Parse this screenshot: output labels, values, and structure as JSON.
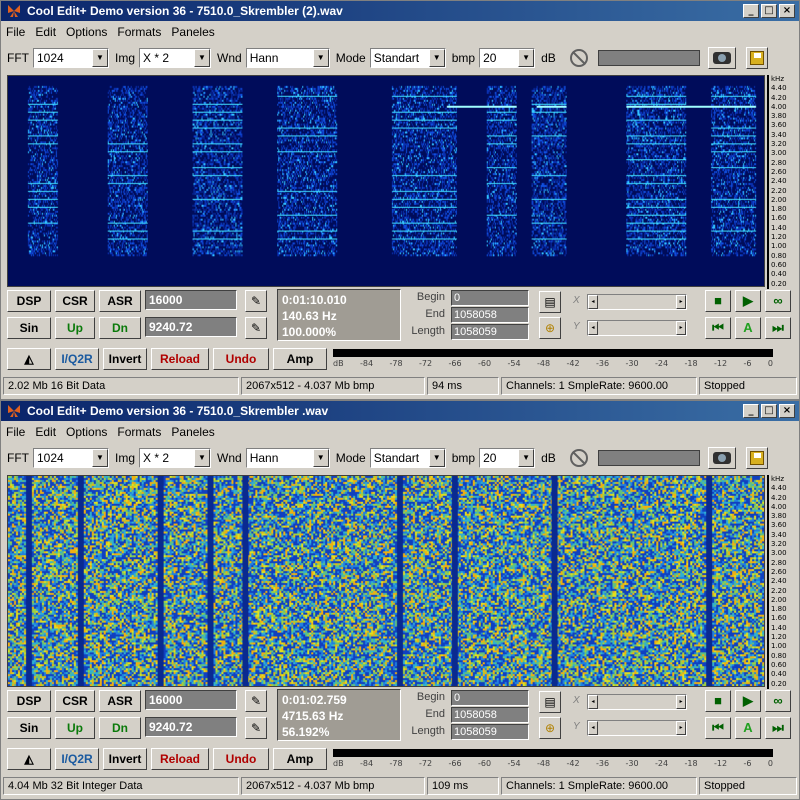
{
  "windows": [
    {
      "title": "Cool Edit+  Demo version 36 - 7510.0_Skrembler  (2).wav",
      "menu": [
        "File",
        "Edit",
        "Options",
        "Formats",
        "Paneles"
      ],
      "toolbar": {
        "fft_label": "FFT",
        "fft": "1024",
        "img_label": "Img",
        "img": "X * 2",
        "wnd_label": "Wnd",
        "wnd": "Hann",
        "mode_label": "Mode",
        "mode": "Standart",
        "bmp_label": "bmp",
        "bmp": "20",
        "db_label": "dB"
      },
      "khz_scale": [
        "kHz",
        "4.40",
        "4.20",
        "4.00",
        "3.80",
        "3.60",
        "3.40",
        "3.20",
        "3.00",
        "2.80",
        "2.60",
        "2.40",
        "2.20",
        "2.00",
        "1.80",
        "1.60",
        "1.40",
        "1.20",
        "1.00",
        "0.80",
        "0.60",
        "0.40",
        "0.20"
      ],
      "buttons": {
        "dsp": "DSP",
        "csr": "CSR",
        "asr": "ASR",
        "sin": "Sin",
        "up": "Up",
        "dn": "Dn"
      },
      "fields": {
        "rate": "16000",
        "freq": "9240.72"
      },
      "readout": {
        "time": "0:01:10.010",
        "hz": "140.63 Hz",
        "pct": "100.000%"
      },
      "range": {
        "begin_label": "Begin",
        "begin": "0",
        "end_label": "End",
        "end": "1058058",
        "length_label": "Length",
        "length": "1058059"
      },
      "axis": {
        "x": "X",
        "y": "Y"
      },
      "row3": {
        "iq": "I/Q2R",
        "invert": "Invert",
        "reload": "Reload",
        "undo": "Undo",
        "amp": "Amp"
      },
      "vu_ticks": [
        "dB",
        "-84",
        "-78",
        "-72",
        "-66",
        "-60",
        "-54",
        "-48",
        "-42",
        "-36",
        "-30",
        "-24",
        "-18",
        "-12",
        "-6",
        "0"
      ],
      "status": [
        "2.02 Mb 16 Bit Data",
        "2067x512 - 4.037 Mb bmp",
        "94 ms",
        "Channels: 1  SmpleRate: 9600.00",
        "Stopped"
      ]
    },
    {
      "title": "Cool Edit+  Demo version 36 - 7510.0_Skrembler .wav",
      "menu": [
        "File",
        "Edit",
        "Options",
        "Formats",
        "Paneles"
      ],
      "toolbar": {
        "fft_label": "FFT",
        "fft": "1024",
        "img_label": "Img",
        "img": "X * 2",
        "wnd_label": "Wnd",
        "wnd": "Hann",
        "mode_label": "Mode",
        "mode": "Standart",
        "bmp_label": "bmp",
        "bmp": "20",
        "db_label": "dB"
      },
      "khz_scale": [
        "kHz",
        "4.40",
        "4.20",
        "4.00",
        "3.80",
        "3.60",
        "3.40",
        "3.20",
        "3.00",
        "2.80",
        "2.60",
        "2.40",
        "2.20",
        "2.00",
        "1.80",
        "1.60",
        "1.40",
        "1.20",
        "1.00",
        "0.80",
        "0.60",
        "0.40",
        "0.20"
      ],
      "buttons": {
        "dsp": "DSP",
        "csr": "CSR",
        "asr": "ASR",
        "sin": "Sin",
        "up": "Up",
        "dn": "Dn"
      },
      "fields": {
        "rate": "16000",
        "freq": "9240.72"
      },
      "readout": {
        "time": "0:01:02.759",
        "hz": "4715.63 Hz",
        "pct": "56.192%"
      },
      "range": {
        "begin_label": "Begin",
        "begin": "0",
        "end_label": "End",
        "end": "1058058",
        "length_label": "Length",
        "length": "1058059"
      },
      "axis": {
        "x": "X",
        "y": "Y"
      },
      "row3": {
        "iq": "I/Q2R",
        "invert": "Invert",
        "reload": "Reload",
        "undo": "Undo",
        "amp": "Amp"
      },
      "vu_ticks": [
        "dB",
        "-84",
        "-78",
        "-72",
        "-66",
        "-60",
        "-54",
        "-48",
        "-42",
        "-36",
        "-30",
        "-24",
        "-18",
        "-12",
        "-6",
        "0"
      ],
      "status": [
        "4.04 Mb 32 Bit Integer Data",
        "2067x512 - 4.037 Mb bmp",
        "109 ms",
        "Channels: 1  SmpleRate: 9600.00",
        "Stopped"
      ]
    }
  ],
  "icons": {
    "app": "butterfly-icon",
    "no_sign": "no-sign-icon",
    "camera": "camera-icon",
    "save": "floppy-icon",
    "pick": "eyedropper-icon",
    "zoom": "magnifier-icon",
    "stop": "stop-icon",
    "play": "play-icon",
    "loop": "loop-icon",
    "prev": "skip-back-icon",
    "mark": "a-marker-icon",
    "next": "skip-forward-icon"
  },
  "colors": {
    "title_start": "#0a246a",
    "title_end": "#3a6ea5",
    "spectro_dark": "#000c5a",
    "spectro_noisy": "#2a8ad0"
  }
}
